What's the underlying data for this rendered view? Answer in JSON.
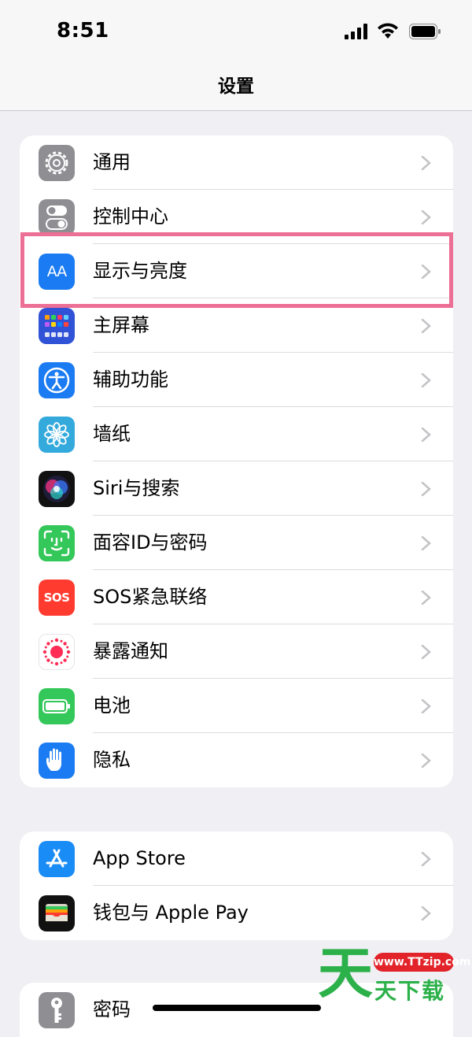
{
  "status_bar": {
    "time": "8:51"
  },
  "nav": {
    "title": "设置"
  },
  "groups": [
    {
      "items": [
        {
          "label": "通用",
          "icon": "gear-icon"
        },
        {
          "label": "控制中心",
          "icon": "switches-icon"
        },
        {
          "label": "显示与亮度",
          "icon": "text-size-icon",
          "icon_text": "AA"
        },
        {
          "label": "主屏幕",
          "icon": "home-grid-icon"
        },
        {
          "label": "辅助功能",
          "icon": "accessibility-icon"
        },
        {
          "label": "墙纸",
          "icon": "flower-icon"
        },
        {
          "label": "Siri与搜索",
          "icon": "siri-icon"
        },
        {
          "label": "面容ID与密码",
          "icon": "face-id-icon"
        },
        {
          "label": "SOS紧急联络",
          "icon": "sos-icon",
          "icon_text": "SOS"
        },
        {
          "label": "暴露通知",
          "icon": "exposure-icon"
        },
        {
          "label": "电池",
          "icon": "battery-icon"
        },
        {
          "label": "隐私",
          "icon": "hand-icon"
        }
      ]
    },
    {
      "items": [
        {
          "label": "App Store",
          "icon": "app-store-icon"
        },
        {
          "label": "钱包与 Apple Pay",
          "icon": "wallet-icon"
        }
      ]
    },
    {
      "items": [
        {
          "label": "密码",
          "icon": "key-icon"
        }
      ]
    }
  ],
  "watermark": {
    "big": "天",
    "url": "www.TTzip.com",
    "small": "天下载"
  },
  "colors": {
    "accent_highlight": "#ec6f95",
    "system_blue": "#1a7bf2",
    "system_green": "#34c759",
    "system_red": "#ff3b30",
    "gray": "#8e8e93"
  }
}
